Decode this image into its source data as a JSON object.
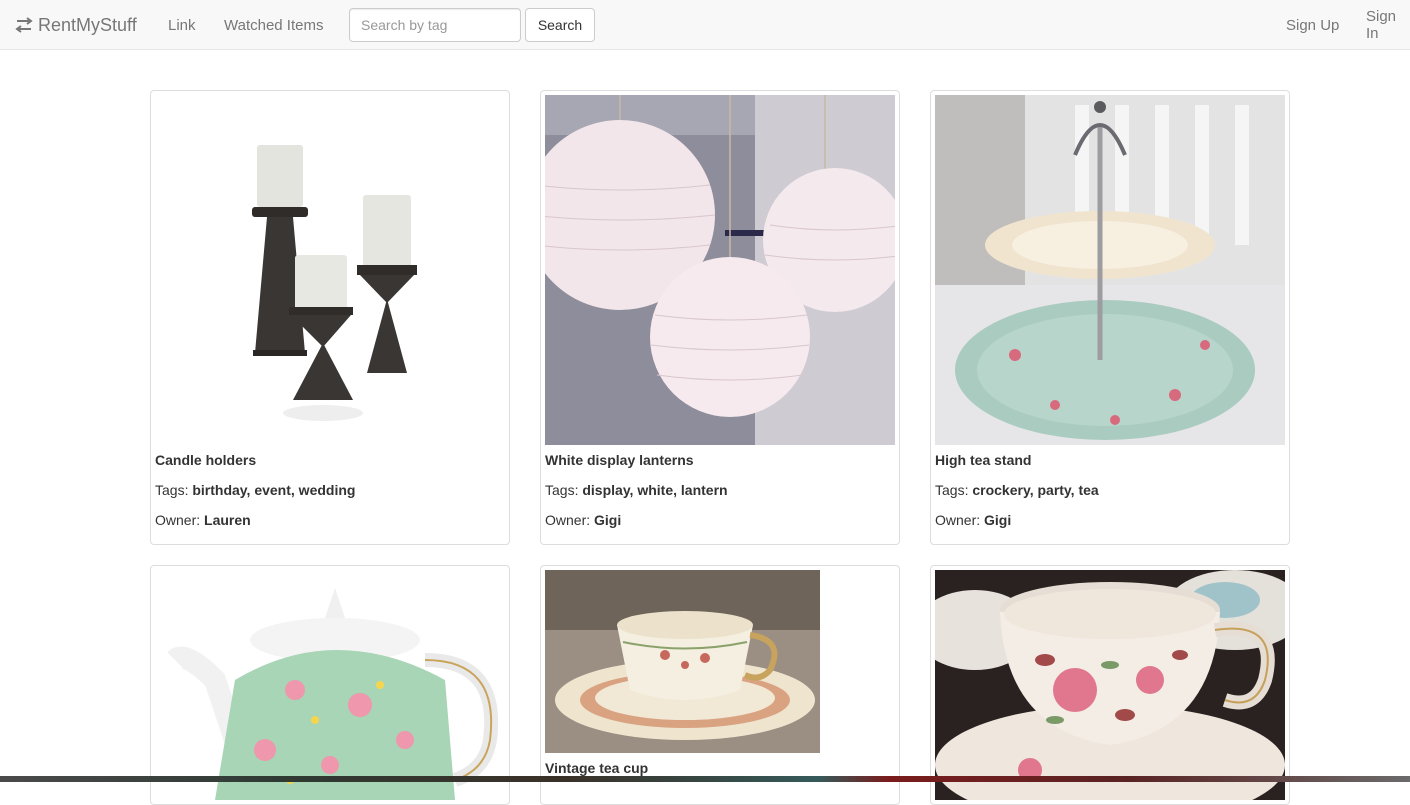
{
  "navbar": {
    "brand": "RentMyStuff",
    "brand_icon": "arrows-exchange-icon",
    "links": [
      "Link",
      "Watched Items"
    ],
    "search": {
      "placeholder": "Search by tag",
      "value": "",
      "button": "Search"
    },
    "auth": {
      "sign_up": "Sign Up",
      "sign_in": "Sign In"
    }
  },
  "labels": {
    "tags": "Tags:",
    "owner": "Owner:"
  },
  "items": [
    {
      "title": "Candle holders",
      "tags": "birthday, event, wedding",
      "owner": "Lauren",
      "image": "candle-holders-image"
    },
    {
      "title": "White display lanterns",
      "tags": "display, white, lantern",
      "owner": "Gigi",
      "image": "paper-lanterns-image"
    },
    {
      "title": "High tea stand",
      "tags": "crockery, party, tea",
      "owner": "Gigi",
      "image": "tea-stand-image"
    },
    {
      "title": "",
      "tags": "",
      "owner": "",
      "image": "floral-teapot-image"
    },
    {
      "title": "Vintage tea cup",
      "tags": "",
      "owner": "",
      "image": "vintage-teacup-image"
    },
    {
      "title": "",
      "tags": "",
      "owner": "",
      "image": "floral-teacup-image"
    }
  ],
  "colors": {
    "navbar_bg": "#f8f8f8",
    "nav_text": "#777777",
    "card_border": "#dddddd"
  }
}
